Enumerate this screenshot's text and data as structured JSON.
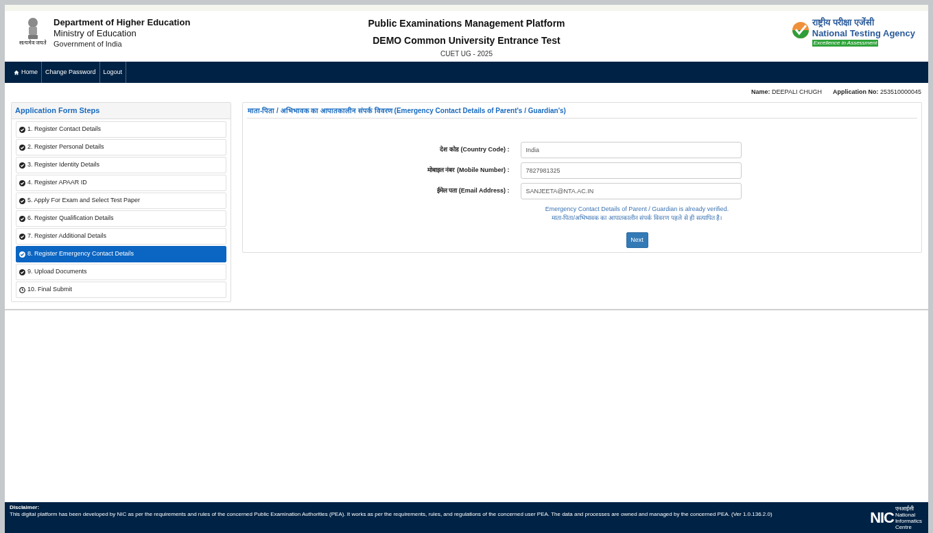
{
  "header": {
    "emblem_motto": "सत्यमेव जयते",
    "department": "Department of Higher Education",
    "ministry": "Ministry of Education",
    "government": "Government of India",
    "platform": "Public Examinations Management Platform",
    "exam": "DEMO Common University Entrance Test",
    "session": "CUET UG - 2025",
    "agency_hindi": "राष्ट्रीय परीक्षा एजेंसी",
    "agency": "National Testing Agency",
    "agency_tagline": "Excellence in Assessment"
  },
  "nav": [
    {
      "label": "Home",
      "kind": "home"
    },
    {
      "label": "Change Password",
      "kind": "link"
    },
    {
      "label": "Logout",
      "kind": "link"
    }
  ],
  "user": {
    "name_label": "Name:",
    "name": "DEEPALI CHUGH",
    "app_label": "Application No:",
    "app_no": "253510000045"
  },
  "steps_title": "Application Form Steps",
  "steps": [
    {
      "label": "1. Register Contact Details",
      "completed": true,
      "selected": false
    },
    {
      "label": "2. Register Personal Details",
      "completed": true,
      "selected": false
    },
    {
      "label": "3. Register Identity Details",
      "completed": true,
      "selected": false
    },
    {
      "label": "4. Register APAAR ID",
      "completed": true,
      "selected": false
    },
    {
      "label": "5. Apply For Exam and Select Test Paper",
      "completed": true,
      "selected": false
    },
    {
      "label": "6. Register Qualification Details",
      "completed": true,
      "selected": false
    },
    {
      "label": "7. Register Additional Details",
      "completed": true,
      "selected": false
    },
    {
      "label": "8. Register Emergency Contact Details",
      "completed": true,
      "selected": true
    },
    {
      "label": "9. Upload Documents",
      "completed": true,
      "selected": false
    },
    {
      "label": "10. Final Submit",
      "completed": false,
      "selected": false
    }
  ],
  "form": {
    "title": "माता-पिता / अभिभावक का आपातकालीन संपर्क विवरण (Emergency Contact Details of Parent's / Guardian's)",
    "fields": [
      {
        "label_hindi": "देश कोड",
        "label": "(Country Code) :",
        "value": "India"
      },
      {
        "label_hindi": "मोबाइल नंबर",
        "label": "(Mobile Number) :",
        "value": "7827981325"
      },
      {
        "label_hindi": "ईमेल पता",
        "label": "(Email Address) :",
        "value": "SANJEETA@NTA.AC.IN"
      }
    ],
    "notice": [
      "Emergency Contact Details of Parent / Guardian is already verified.",
      "माता-पिता/अभिभावक का आपातकालीन संपर्क विवरण पहले से ही सत्यापित है।"
    ],
    "button": "Next"
  },
  "footer": {
    "title": "Disclaimer:",
    "text": "This digital platform has been developed by NIC as per the requirements and rules of the concerned Public Examination Authorities (PEA). It works as per the requirements, rules, and regulations of the concerned user PEA. The data and processes are owned and managed by the concerned PEA. (Ver 1.0.136.2.0)",
    "logo_mark": "NIC",
    "logo_hindi": "एनआईसी",
    "logo_name": [
      "National",
      "Informatics",
      "Centre"
    ]
  }
}
